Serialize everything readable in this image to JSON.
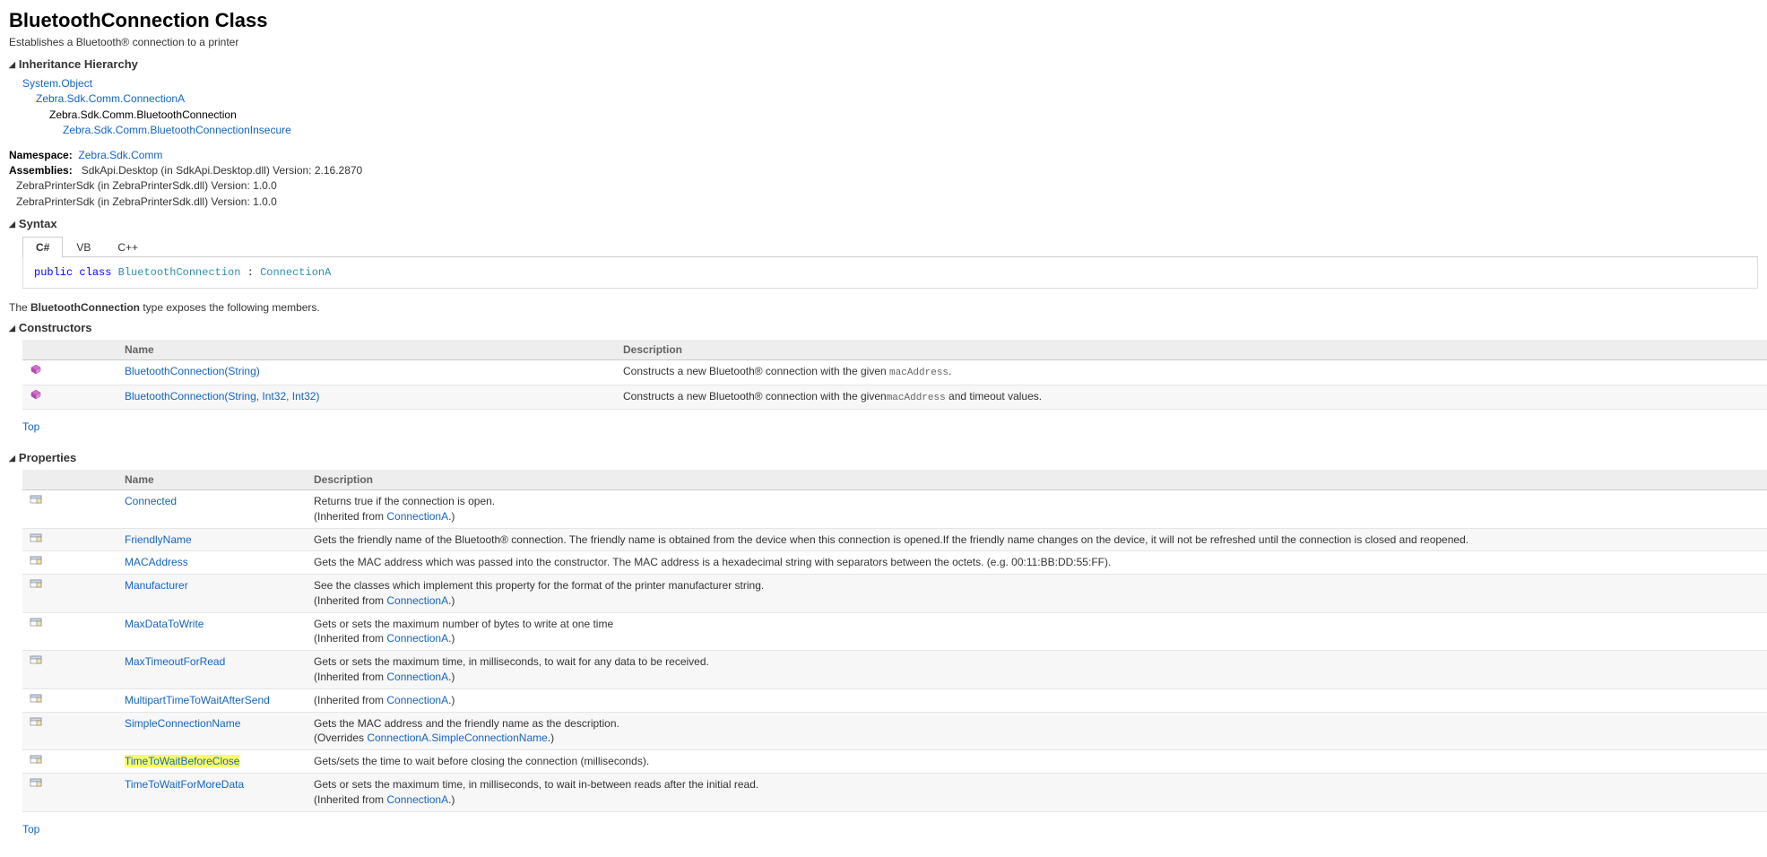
{
  "title": "BluetoothConnection Class",
  "subtitle": "Establishes a Bluetooth® connection to a printer",
  "sections": {
    "hierarchy_label": "Inheritance Hierarchy",
    "syntax_label": "Syntax",
    "constructors_label": "Constructors",
    "properties_label": "Properties"
  },
  "hierarchy": {
    "l0": "System.Object",
    "l1": "Zebra.Sdk.Comm.ConnectionA",
    "l2": "Zebra.Sdk.Comm.BluetoothConnection",
    "l3": "Zebra.Sdk.Comm.BluetoothConnectionInsecure"
  },
  "meta": {
    "namespace_label": "Namespace:",
    "namespace": "Zebra.Sdk.Comm",
    "assemblies_label": "Assemblies:",
    "assembly_0": "SdkApi.Desktop (in SdkApi.Desktop.dll) Version: 2.16.2870",
    "assembly_1": "ZebraPrinterSdk (in ZebraPrinterSdk.dll) Version: 1.0.0",
    "assembly_2": "ZebraPrinterSdk (in ZebraPrinterSdk.dll) Version: 1.0.0"
  },
  "syntax_tabs": {
    "csharp": "C#",
    "vb": "VB",
    "cpp": "C++"
  },
  "syntax": {
    "kw_public": "public",
    "kw_class": "class",
    "type_name": "BluetoothConnection",
    "colon": " : ",
    "base_type": "ConnectionA"
  },
  "exposes_pre": "The ",
  "exposes_type": "BluetoothConnection",
  "exposes_post": " type exposes the following members.",
  "headers": {
    "name": "Name",
    "description": "Description"
  },
  "constructors": [
    {
      "name": "BluetoothConnection(String)",
      "desc_pre": "Constructs a new Bluetooth® connection with the given ",
      "desc_code": "macAddress",
      "desc_post": "."
    },
    {
      "name": "BluetoothConnection(String, Int32, Int32)",
      "desc_pre": "Constructs a new Bluetooth® connection with the given",
      "desc_code": "macAddress",
      "desc_post": " and timeout values."
    }
  ],
  "properties": [
    {
      "name": "Connected",
      "line1": "Returns true if the connection is open.",
      "inh_pre": "(Inherited from ",
      "inh_link": "ConnectionA",
      "inh_post": ".)"
    },
    {
      "name": "FriendlyName",
      "line1": "Gets the friendly name of the Bluetooth® connection. The friendly name is obtained from the device when this connection is opened.If the friendly name changes on the device, it will not be refreshed until the connection is closed and reopened."
    },
    {
      "name": "MACAddress",
      "line1": "Gets the MAC address which was passed into the constructor. The MAC address is a hexadecimal string with separators between the octets. (e.g. 00:11:BB:DD:55:FF)."
    },
    {
      "name": "Manufacturer",
      "line1": "See the classes which implement this property for the format of the printer manufacturer string.",
      "inh_pre": "(Inherited from ",
      "inh_link": "ConnectionA",
      "inh_post": ".)"
    },
    {
      "name": "MaxDataToWrite",
      "line1": "Gets or sets the maximum number of bytes to write at one time",
      "inh_pre": "(Inherited from ",
      "inh_link": "ConnectionA",
      "inh_post": ".)"
    },
    {
      "name": "MaxTimeoutForRead",
      "line1": "Gets or sets the maximum time, in milliseconds, to wait for any data to be received.",
      "inh_pre": "(Inherited from ",
      "inh_link": "ConnectionA",
      "inh_post": ".)"
    },
    {
      "name": "MultipartTimeToWaitAfterSend",
      "inh_pre": "(Inherited from ",
      "inh_link": "ConnectionA",
      "inh_post": ".)"
    },
    {
      "name": "SimpleConnectionName",
      "line1": "Gets the MAC address and the friendly name as the description.",
      "ovr_pre": "(Overrides ",
      "ovr_link": "ConnectionA.SimpleConnectionName",
      "ovr_post": ".)"
    },
    {
      "name": "TimeToWaitBeforeClose",
      "highlight": true,
      "line1": "Gets/sets the time to wait before closing the connection (milliseconds)."
    },
    {
      "name": "TimeToWaitForMoreData",
      "line1": "Gets or sets the maximum time, in milliseconds, to wait in-between reads after the initial read.",
      "inh_pre": "(Inherited from ",
      "inh_link": "ConnectionA",
      "inh_post": ".)"
    }
  ],
  "top_label": "Top"
}
